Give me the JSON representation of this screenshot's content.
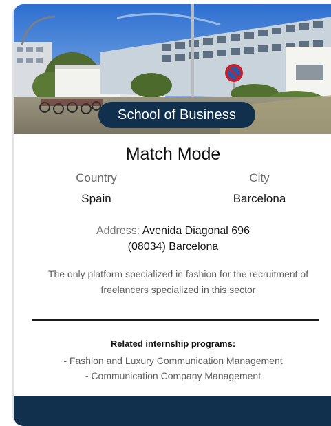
{
  "card": {
    "image_alt": "School building photo",
    "badge": "School of Business",
    "title": "Match Mode",
    "country_label": "Country",
    "country_value": "Spain",
    "city_label": "City",
    "city_value": "Barcelona",
    "address_label": "Address:",
    "address_line1": "Avenida Diagonal 696",
    "address_line2": "(08034) Barcelona",
    "description": "The only platform specialized in fashion for the recruitment of freelancers specialized in this sector",
    "programs_title": "Related internship programs:",
    "programs": [
      "- Fashion and Luxury Communication Management",
      "- Communication Company Management"
    ]
  },
  "colors": {
    "brand_dark": "#11304d",
    "muted_text": "#6a6a6a"
  }
}
